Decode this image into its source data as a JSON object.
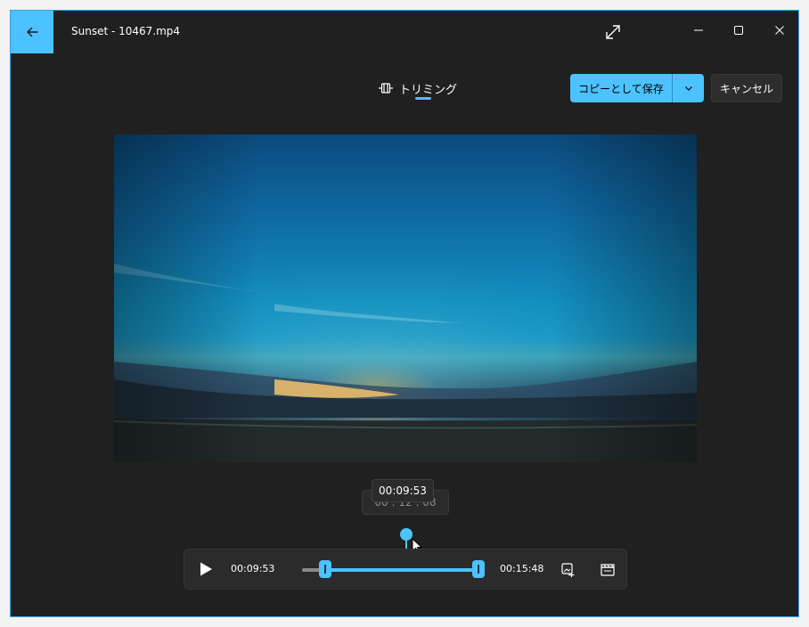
{
  "window": {
    "title": "Sunset - 10467.mp4"
  },
  "mode": {
    "label": "トリミング"
  },
  "actions": {
    "save_copy": "コピーとして保存",
    "cancel": "キャンセル"
  },
  "tooltip": {
    "time": "00:09:53",
    "behind": "00 : 12 : 08"
  },
  "player": {
    "current_time": "00:09:53",
    "end_time": "00:15:48"
  },
  "colors": {
    "accent": "#4cc2ff",
    "window_bg": "#202020",
    "panel_bg": "#2b2b2b"
  }
}
